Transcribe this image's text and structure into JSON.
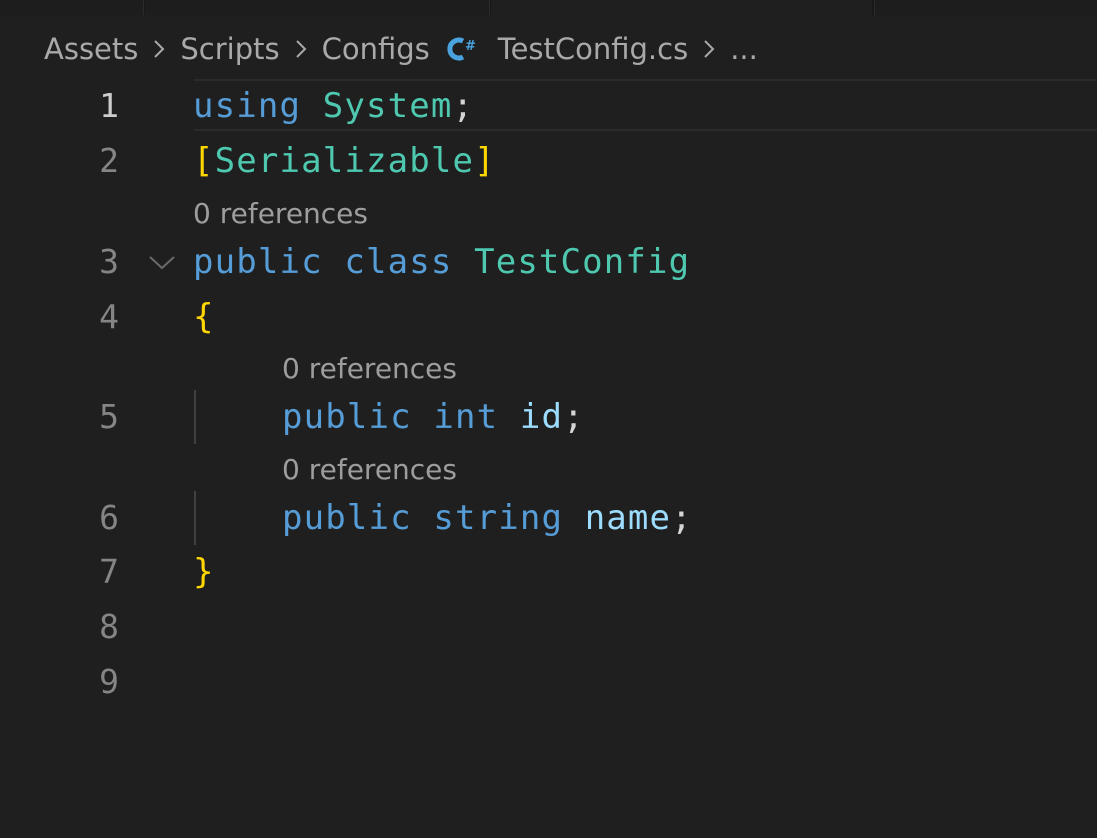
{
  "tabs": [
    "",
    "",
    "",
    ""
  ],
  "breadcrumb": {
    "items": [
      "Assets",
      "Scripts",
      "Configs",
      "TestConfig.cs",
      "..."
    ],
    "file_icon": "csharp-file-icon",
    "separator_icon": "chevron-right-icon"
  },
  "editor": {
    "active_line": 1,
    "line_numbers": [
      "1",
      "2",
      "3",
      "4",
      "5",
      "6",
      "7",
      "8",
      "9"
    ],
    "codelens": [
      "0 references",
      "0 references",
      "0 references"
    ],
    "lines": {
      "l1": {
        "kw": "using",
        "type": "System",
        "punc": ";"
      },
      "l2": {
        "open": "[",
        "type": "Serializable",
        "close": "]"
      },
      "l3": {
        "kw1": "public",
        "kw2": "class",
        "type": "TestConfig"
      },
      "l4": {
        "brace": "{"
      },
      "l5": {
        "kw1": "public",
        "kw2": "int",
        "var": "id",
        "punc": ";"
      },
      "l6": {
        "kw1": "public",
        "kw2": "string",
        "var": "name",
        "punc": ";"
      },
      "l7": {
        "brace": "}"
      }
    }
  },
  "colors": {
    "background": "#1f1f1f",
    "keyword": "#569cd6",
    "type": "#4ec9b0",
    "variable": "#9cdcfe",
    "bracket": "#ffd700",
    "line_number": "#858585",
    "codelens": "#9d9d9d"
  }
}
